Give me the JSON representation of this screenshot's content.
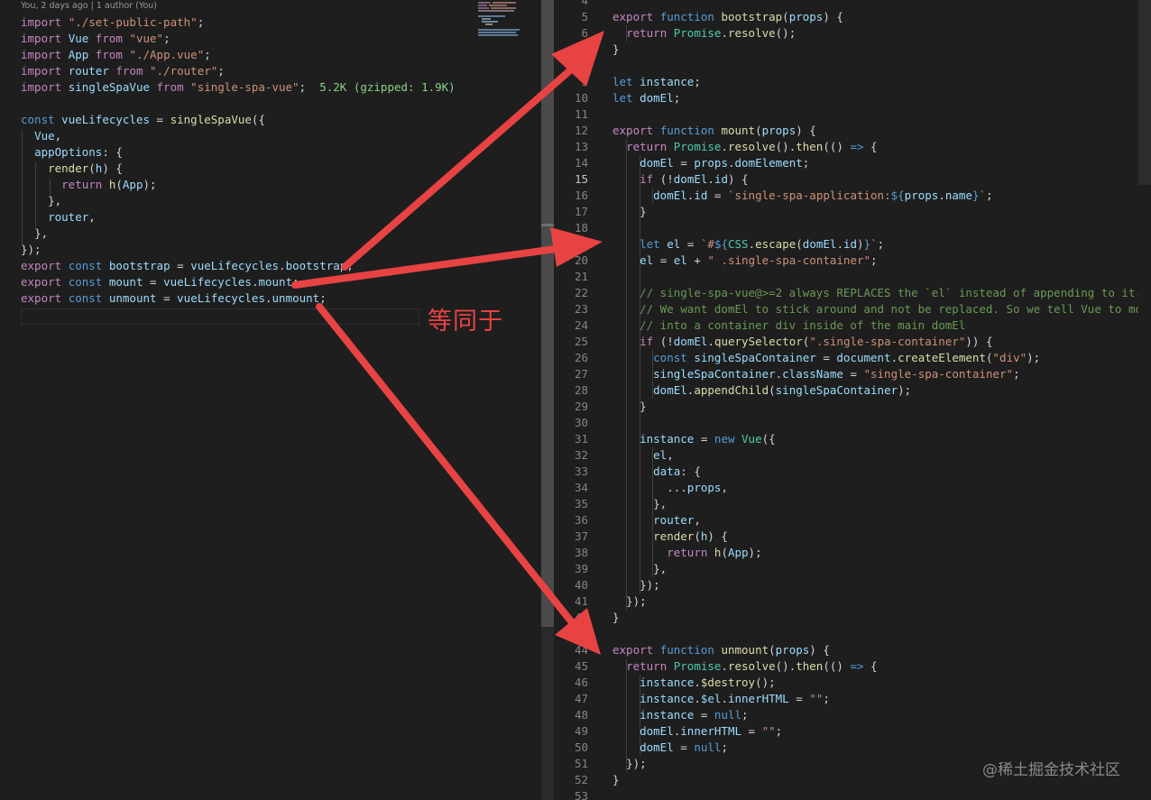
{
  "left_editor": {
    "codelens": "You, 2 days ago | 1 author (You)",
    "import_size_hint": "5.2K (gzipped: 1.9K)"
  },
  "annotations": {
    "equivalence_label": "等同于",
    "watermark": "@稀土掘金技术社区"
  },
  "right_editor": {
    "active_line": 15,
    "line_numbers": [
      4,
      5,
      6,
      7,
      8,
      9,
      10,
      11,
      12,
      13,
      14,
      15,
      16,
      17,
      18,
      19,
      20,
      21,
      22,
      23,
      24,
      25,
      26,
      27,
      28,
      29,
      30,
      31,
      32,
      33,
      34,
      35,
      36,
      37,
      38,
      39,
      40,
      41,
      42,
      43,
      44,
      45,
      46,
      47,
      48,
      49,
      50,
      51,
      52,
      53
    ]
  },
  "colors": {
    "background": "#1e1e1e",
    "keyword_import": "#c586c0",
    "keyword": "#569cd6",
    "string": "#ce9178",
    "function": "#dcdcaa",
    "variable": "#9cdcfe",
    "comment": "#6a9955",
    "type": "#4ec9b0",
    "arrow_annotation": "#e84343"
  }
}
